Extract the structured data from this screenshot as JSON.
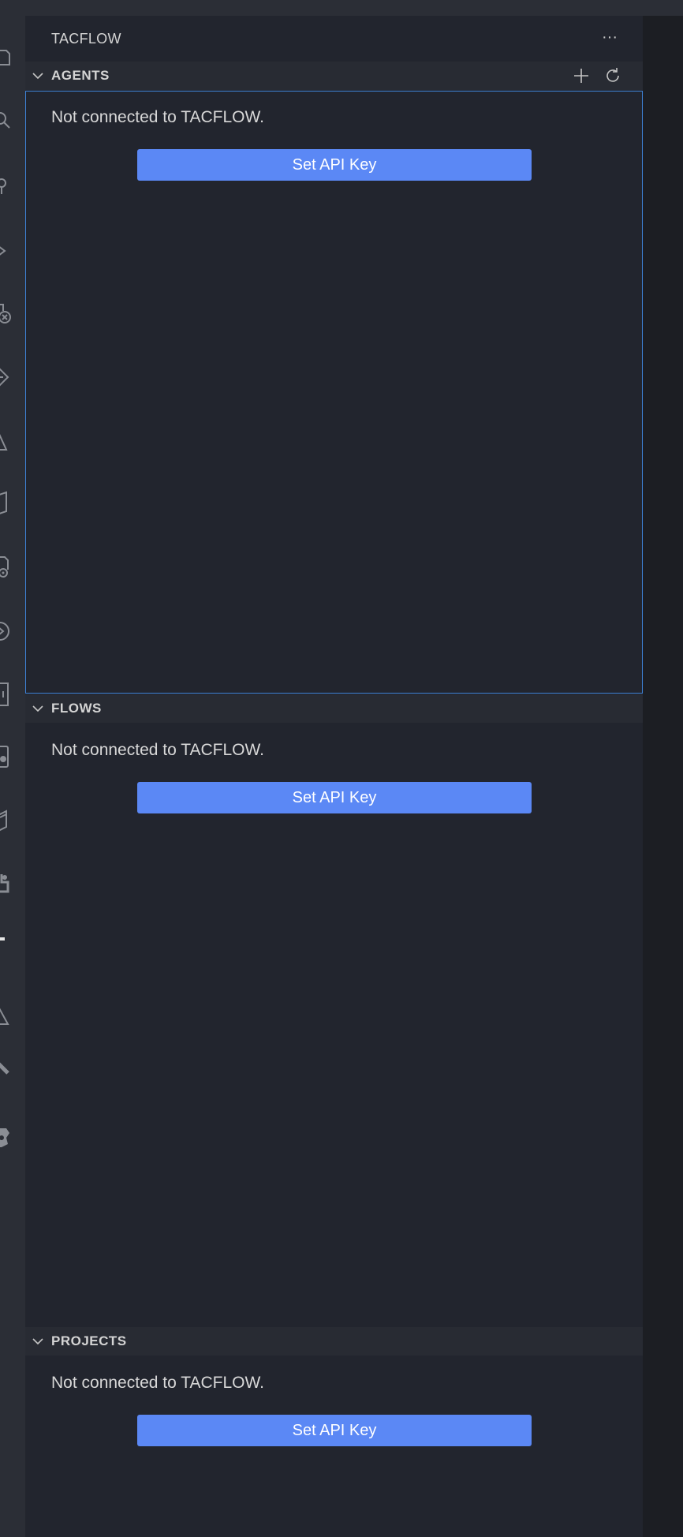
{
  "sidebar": {
    "title": "TACFLOW",
    "more_actions_glyph": "···"
  },
  "activity_bar": {
    "icons": [
      "files-icon",
      "search-icon",
      "source-control-icon",
      "run-debug-icon",
      "extensions-icon",
      "remote-explorer-icon",
      "testing-icon",
      "package-icon",
      "settings-file-icon",
      "live-share-icon",
      "notebook-icon",
      "docker-icon",
      "database-icon",
      "python-icon",
      "tacflow-icon",
      "triangle-icon",
      "hammer-icon",
      "gear-puzzle-icon"
    ]
  },
  "sections": {
    "agents": {
      "title": "AGENTS",
      "message": "Not connected to TACFLOW.",
      "button_label": "Set API Key"
    },
    "flows": {
      "title": "FLOWS",
      "message": "Not connected to TACFLOW.",
      "button_label": "Set API Key"
    },
    "projects": {
      "title": "PROJECTS",
      "message": "Not connected to TACFLOW.",
      "button_label": "Set API Key"
    }
  },
  "colors": {
    "accent_button": "#5b88f5",
    "focus_border": "#3e82d6",
    "sidebar_bg": "#22252e",
    "section_header_bg": "#282b33"
  }
}
